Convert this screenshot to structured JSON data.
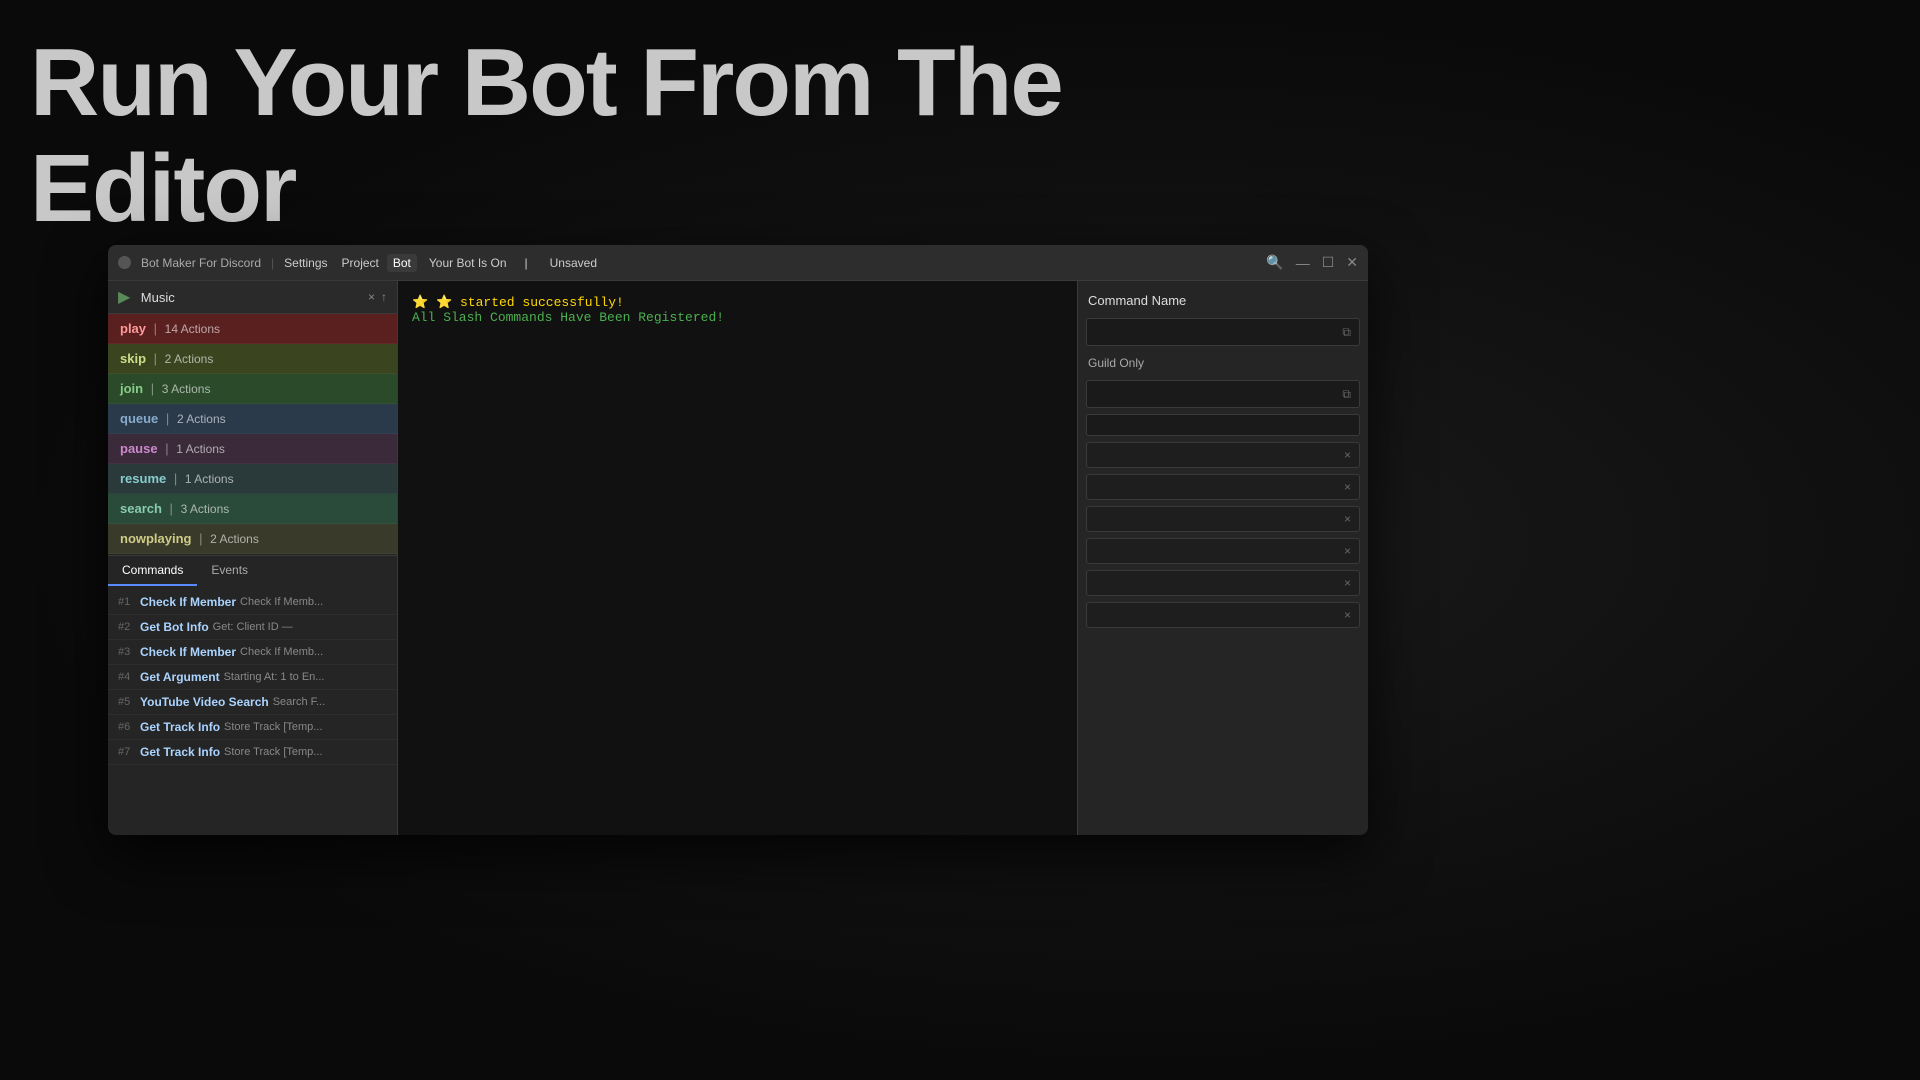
{
  "hero": {
    "title_line1": "Run Your Bot From The",
    "title_line2": "Editor"
  },
  "window": {
    "traffic_light": "●",
    "app_name": "Bot Maker For Discord",
    "separator": "|",
    "menu": {
      "settings": "Settings",
      "project": "Project",
      "bot": "Bot",
      "bot_status": "Your Bot Is On",
      "status_sep": "|",
      "unsaved": "Unsaved"
    },
    "titlebar_right_icons": [
      "🔍",
      "—",
      "☐",
      "✕"
    ]
  },
  "folder": {
    "name": "Music",
    "close_icon": "×",
    "up_icon": "↑"
  },
  "commands": [
    {
      "name": "play",
      "actions": "14 Actions",
      "style": "cmd-play"
    },
    {
      "name": "skip",
      "actions": "2 Actions",
      "style": "cmd-skip"
    },
    {
      "name": "join",
      "actions": "3 Actions",
      "style": "cmd-join"
    },
    {
      "name": "queue",
      "actions": "2 Actions",
      "style": "cmd-queue"
    },
    {
      "name": "pause",
      "actions": "1 Actions",
      "style": "cmd-pause"
    },
    {
      "name": "resume",
      "actions": "1 Actions",
      "style": "cmd-resume"
    },
    {
      "name": "search",
      "actions": "3 Actions",
      "style": "cmd-search"
    },
    {
      "name": "nowplaying",
      "actions": "2 Actions",
      "style": "cmd-nowplaying"
    }
  ],
  "tabs": {
    "commands": "Commands",
    "events": "Events"
  },
  "actions": [
    {
      "num": "#1",
      "name": "Check If Member",
      "detail": "Check If Memb..."
    },
    {
      "num": "#2",
      "name": "Get Bot Info",
      "detail": "Get: Client ID —"
    },
    {
      "num": "#3",
      "name": "Check If Member",
      "detail": "Check If Memb..."
    },
    {
      "num": "#4",
      "name": "Get Argument",
      "detail": "Starting At: 1 to En..."
    },
    {
      "num": "#5",
      "name": "YouTube Video Search",
      "detail": "Search F..."
    },
    {
      "num": "#6",
      "name": "Get Track Info",
      "detail": "Store Track [Temp..."
    },
    {
      "num": "#7",
      "name": "Get Track Info",
      "detail": "Store Track [Temp..."
    }
  ],
  "console": {
    "line1": "⭐ started successfully!",
    "line2": "All Slash Commands Have Been Registered!"
  },
  "right_panel": {
    "title": "Command Name",
    "guild_only_label": "Guild Only",
    "rows": [
      "",
      "",
      "",
      "",
      "",
      ""
    ]
  }
}
